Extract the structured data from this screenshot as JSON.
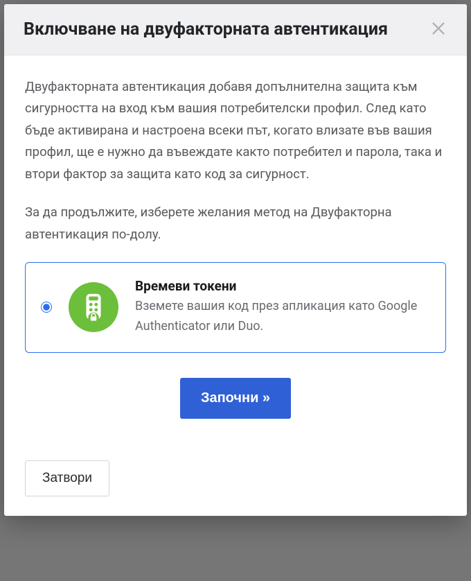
{
  "header": {
    "title": "Включване на двуфакторната автентикация"
  },
  "body": {
    "paragraph1": "Двуфакторната автентикация добавя допълнителна защита към сигурността на вход към вашия потребителски профил. След като бъде активирана и настроена всеки път, когато влизате във вашия профил, ще е нужно да въвеждате както потребител и парола, така и втори фактор за защита като код за сигурност.",
    "paragraph2": "За да продължите, изберете желания метод на Двуфакторна автентикация по-долу."
  },
  "option": {
    "title": "Времеви токени",
    "description": "Вземете вашия код през апликация като Google Authenticator или Duo."
  },
  "buttons": {
    "start": "Започни »",
    "close": "Затвори"
  }
}
